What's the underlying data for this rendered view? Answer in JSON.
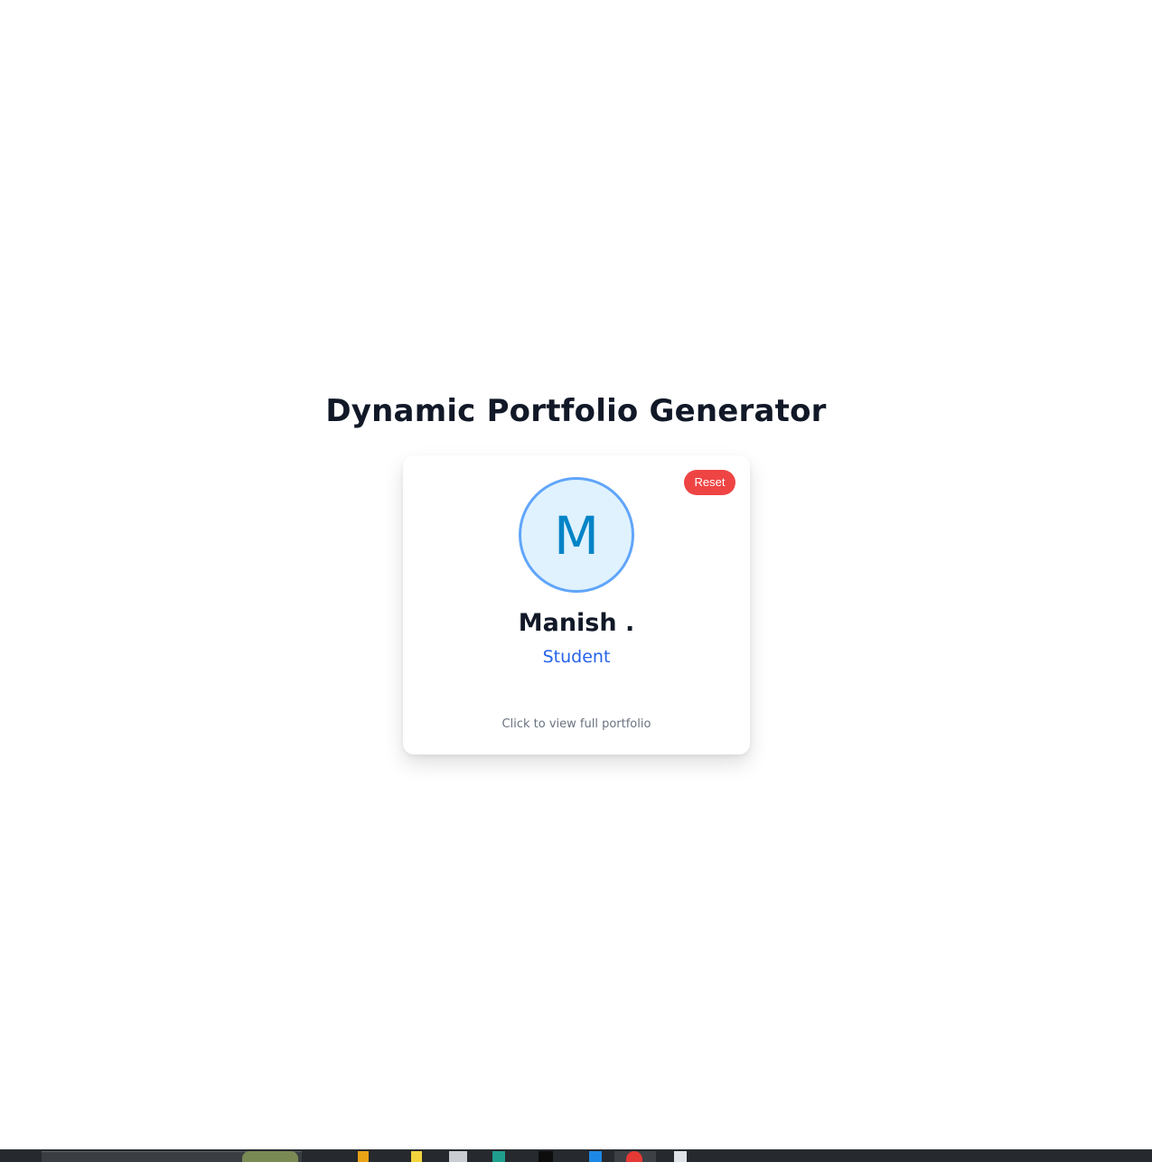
{
  "page": {
    "title": "Dynamic Portfolio Generator"
  },
  "card": {
    "reset_label": "Reset",
    "avatar_initial": "M",
    "name": "Manish .",
    "role": "Student",
    "hint": "Click to view full portfolio"
  },
  "colors": {
    "title_text": "#111827",
    "reset_bg": "#ef4444",
    "avatar_border": "#60a5fa",
    "avatar_bg": "#e0f2fe",
    "avatar_text": "#0284c7",
    "role_text": "#2563eb",
    "hint_text": "#6b7280",
    "taskbar_bg": "#26292d"
  },
  "taskbar": {
    "icons": [
      "search-box",
      "app-icon",
      "app-icon",
      "app-icon",
      "app-icon",
      "app-icon",
      "app-icon",
      "browser-icon",
      "file-icon"
    ]
  }
}
